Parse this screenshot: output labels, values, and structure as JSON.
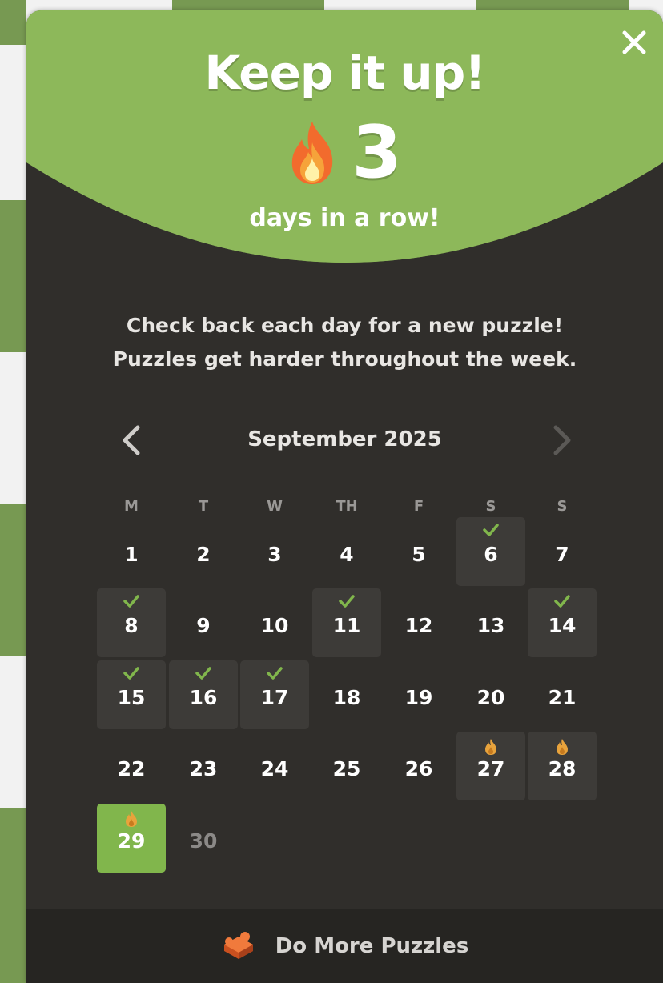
{
  "header": {
    "title": "Keep it up!",
    "streak_count": "3",
    "streak_label": "days in a row!"
  },
  "message": {
    "line1": "Check back each day for a new puzzle!",
    "line2": "Puzzles get harder throughout the week."
  },
  "calendar": {
    "month_label": "September 2025",
    "weekdays": [
      "M",
      "T",
      "W",
      "TH",
      "F",
      "S",
      "S"
    ],
    "days": [
      {
        "label": "1",
        "state": "plain"
      },
      {
        "label": "2",
        "state": "plain"
      },
      {
        "label": "3",
        "state": "plain"
      },
      {
        "label": "4",
        "state": "plain"
      },
      {
        "label": "5",
        "state": "plain"
      },
      {
        "label": "6",
        "state": "solved"
      },
      {
        "label": "7",
        "state": "plain"
      },
      {
        "label": "8",
        "state": "solved"
      },
      {
        "label": "9",
        "state": "plain"
      },
      {
        "label": "10",
        "state": "plain"
      },
      {
        "label": "11",
        "state": "solved"
      },
      {
        "label": "12",
        "state": "plain"
      },
      {
        "label": "13",
        "state": "plain"
      },
      {
        "label": "14",
        "state": "solved"
      },
      {
        "label": "15",
        "state": "solved"
      },
      {
        "label": "16",
        "state": "solved"
      },
      {
        "label": "17",
        "state": "solved"
      },
      {
        "label": "18",
        "state": "plain"
      },
      {
        "label": "19",
        "state": "plain"
      },
      {
        "label": "20",
        "state": "plain"
      },
      {
        "label": "21",
        "state": "plain"
      },
      {
        "label": "22",
        "state": "plain"
      },
      {
        "label": "23",
        "state": "plain"
      },
      {
        "label": "24",
        "state": "plain"
      },
      {
        "label": "25",
        "state": "plain"
      },
      {
        "label": "26",
        "state": "plain"
      },
      {
        "label": "27",
        "state": "streak"
      },
      {
        "label": "28",
        "state": "streak"
      },
      {
        "label": "29",
        "state": "today"
      },
      {
        "label": "30",
        "state": "future"
      }
    ]
  },
  "footer": {
    "label": "Do More Puzzles"
  },
  "colors": {
    "accent_green": "#81b64c",
    "panel_bg": "#302e2b",
    "check_green": "#81b64c",
    "flame_orange": "#e8a33c"
  },
  "icons": {
    "close": "close-icon",
    "streak": "fire-icon",
    "prev": "chevron-left-icon",
    "next": "chevron-right-icon",
    "solved": "check-icon",
    "streak_day": "flame-icon",
    "footer": "puzzle-piece-icon"
  }
}
